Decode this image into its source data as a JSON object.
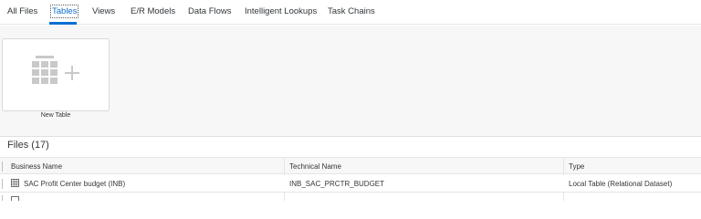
{
  "tabs": [
    {
      "label": "All Files",
      "active": false
    },
    {
      "label": "Tables",
      "active": true
    },
    {
      "label": "Views",
      "active": false
    },
    {
      "label": "E/R Models",
      "active": false
    },
    {
      "label": "Data Flows",
      "active": false
    },
    {
      "label": "Intelligent Lookups",
      "active": false
    },
    {
      "label": "Task Chains",
      "active": false
    }
  ],
  "new_tile": {
    "label": "New Table",
    "icon": "table-add-icon"
  },
  "files": {
    "title": "Files (17)"
  },
  "table": {
    "columns": [
      "Business Name",
      "Technical Name",
      "Type"
    ],
    "rows": [
      {
        "business_name": "SAC Profit Center budget (INB)",
        "technical_name": "INB_SAC_PRCTR_BUDGET",
        "type": "Local Table (Relational Dataset)",
        "icon": "table-icon"
      }
    ]
  },
  "colors": {
    "accent": "#0a6ed1",
    "text": "#32363a",
    "border": "#e5e5e5"
  }
}
